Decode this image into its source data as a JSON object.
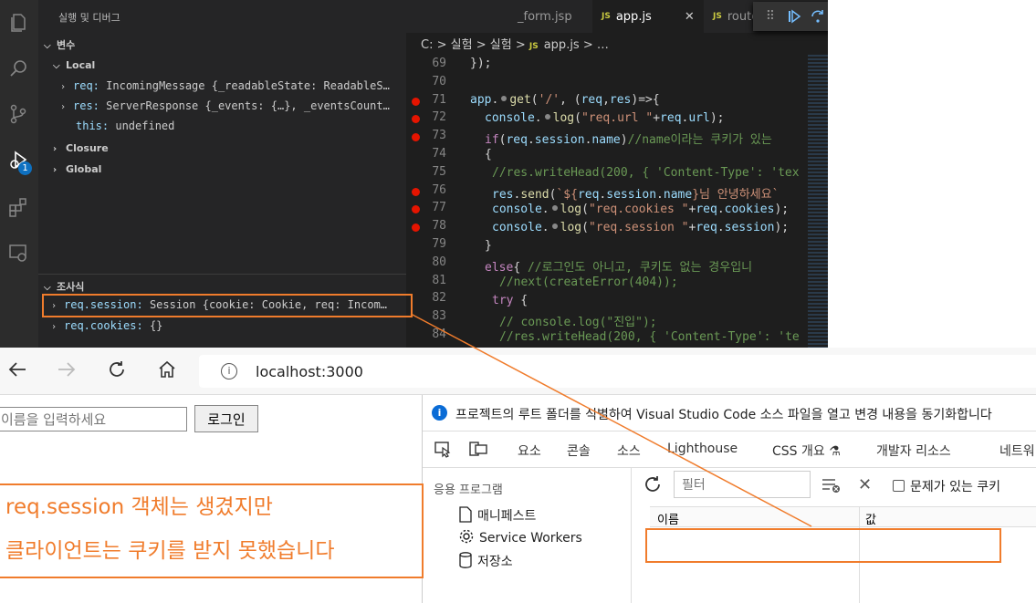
{
  "vscode": {
    "sidebar_title": "실행 및 디버그",
    "variables_section": "변수",
    "local_group": "Local",
    "locals": [
      {
        "name": "req:",
        "value": "IncomingMessage {_readableState: ReadableS…"
      },
      {
        "name": "res:",
        "value": "ServerResponse {_events: {…}, _eventsCount…"
      },
      {
        "name": "this:",
        "value": "undefined"
      }
    ],
    "closure_group": "Closure",
    "global_group": "Global",
    "watch_section": "조사식",
    "watch": [
      {
        "name": "req.session:",
        "value": "Session {cookie: Cookie, req: Incom…"
      },
      {
        "name": "req.cookies:",
        "value": "{}"
      }
    ],
    "debug_badge": "1",
    "tabs": [
      {
        "label": "_form.jsp",
        "active": false
      },
      {
        "label": "app.js",
        "active": true,
        "close": "✕"
      },
      {
        "label": "route.js",
        "active": false
      }
    ],
    "tab_js_marker": "JS",
    "breadcrumb": {
      "root": "C:",
      "sep": ">",
      "p1": "실험",
      "p2": "실험",
      "file": "app.js",
      "tail": "…"
    },
    "line_numbers": [
      "69",
      "70",
      "71",
      "72",
      "73",
      "74",
      "75",
      "76",
      "77",
      "78",
      "79",
      "80",
      "81",
      "82",
      "83",
      "84"
    ],
    "breakpoint_lines": [
      "71",
      "72",
      "73",
      "76",
      "77",
      "78"
    ]
  },
  "browser": {
    "url": "localhost:3000",
    "page": {
      "name_placeholder": "이름을 입력하세요",
      "login_label": "로그인"
    },
    "devtools": {
      "info": "프로젝트의 루트 폴더를 식별하여 Visual Studio Code 소스 파일을 열고 변경 내용을 동기화합니다",
      "tabs": [
        "요소",
        "콘솔",
        "소스",
        "Lighthouse",
        "CSS 개요",
        "개발자 리소스",
        "네트워"
      ],
      "app_section": "응용 프로그램",
      "tree": [
        "매니페스트",
        "Service Workers",
        "저장소"
      ],
      "filter_placeholder": "필터",
      "problem_cookies_label": "문제가 있는 쿠키",
      "col_name": "이름",
      "col_value": "값"
    }
  },
  "annotation": {
    "line1": "req.session 객체는 생겼지만",
    "line2": "클라이언트는 쿠키를 받지 못했습니다",
    "color": "#f07c2c"
  }
}
